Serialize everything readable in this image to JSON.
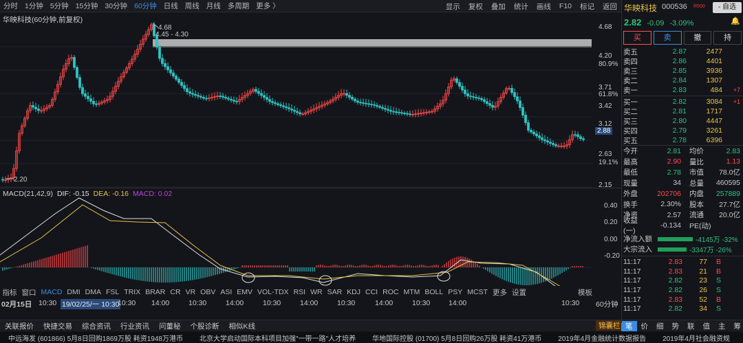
{
  "toolbar": {
    "timeframes": [
      "分时",
      "1分钟",
      "5分钟",
      "15分钟",
      "30分钟",
      "60分钟",
      "日线",
      "周线",
      "月线",
      "多周期",
      "更多 〉"
    ],
    "active_timeframe": "60分钟",
    "right_items": [
      "显示",
      "复权",
      "叠加",
      "统计",
      "画线",
      "F10",
      "标记",
      "返回"
    ]
  },
  "chart": {
    "title": "华映科技(60分钟,前复权)",
    "high_label": "4.68",
    "range_label": "4.45 - 4.30",
    "low_label": "2.20",
    "current_price_tag": "2.88",
    "price_axis": [
      "4.68",
      "4.20",
      "80.9%",
      "3.71",
      "61.8%",
      "3.42",
      "3.12",
      "2.88",
      "2.63",
      "19.1%",
      "2.15"
    ]
  },
  "macd": {
    "name": "MACD(21,42,9)",
    "dif_label": "DIF: -0.15",
    "dea_label": "DEA: -0.16",
    "macd_label": "MACD: 0.02",
    "axis": [
      "0.40",
      "0.20",
      "0.00",
      "-0.20"
    ]
  },
  "indicator_tabs": [
    "指标",
    "窗口",
    "MACD",
    "DMI",
    "DMA",
    "FSL",
    "TRIX",
    "BRAR",
    "CR",
    "VR",
    "OBV",
    "ASI",
    "EMV",
    "VOL-TDX",
    "RSI",
    "WR",
    "SAR",
    "KDJ",
    "CCI",
    "ROC",
    "MTM",
    "BOLL",
    "PSY",
    "MCST",
    "更多",
    "设置"
  ],
  "active_indicator": "MACD",
  "template_label": "模板",
  "time_axis": [
    "02月15日",
    "10:30",
    "19/02/25/一 10:30",
    "10:30",
    "14:00",
    "10:30",
    "14:00",
    "10:30",
    "14:00",
    "10:30",
    "14:00",
    "10:30",
    "14:00",
    "10:30",
    "60分钟"
  ],
  "bottom_tabs": [
    "关联报价",
    "快捷交易",
    "综合资讯",
    "行业资讯",
    "问董秘",
    "个股诊断",
    "相似K线"
  ],
  "luck_label": "锦囊栏",
  "side_tabs": [
    "笔",
    "价",
    "细",
    "势",
    "联",
    "值",
    "主",
    "筹"
  ],
  "active_side_tab": "笔",
  "news": [
    "中远海发 (601866) 5月8日回购1869万股 耗资1948万港币",
    "北京大学启动国际本科项目加强\"一带一路\"人才培养",
    "华地国际控股 (01700) 5月8日回购26万股 耗资41万港币",
    "2019年4月金融统计数据报告",
    "2019年4月社会融资规"
  ],
  "quote": {
    "name": "华映科技",
    "code": "000536",
    "badge": "R500",
    "watch_button": "- 自选",
    "price": "2.82",
    "change": "-0.09",
    "pct": "-3.09%",
    "buttons": [
      "买",
      "卖",
      "撤",
      "持"
    ],
    "asks": [
      {
        "label": "卖五",
        "price": "2.87",
        "vol": "2477",
        "delta": ""
      },
      {
        "label": "卖四",
        "price": "2.86",
        "vol": "4401",
        "delta": ""
      },
      {
        "label": "卖三",
        "price": "2.85",
        "vol": "3936",
        "delta": ""
      },
      {
        "label": "卖二",
        "price": "2.84",
        "vol": "1307",
        "delta": ""
      },
      {
        "label": "卖一",
        "price": "2.83",
        "vol": "484",
        "delta": "+7"
      }
    ],
    "bids": [
      {
        "label": "买一",
        "price": "2.82",
        "vol": "3084",
        "delta": "+1"
      },
      {
        "label": "买二",
        "price": "2.81",
        "vol": "1717",
        "delta": ""
      },
      {
        "label": "买三",
        "price": "2.80",
        "vol": "4447",
        "delta": ""
      },
      {
        "label": "买四",
        "price": "2.79",
        "vol": "3261",
        "delta": ""
      },
      {
        "label": "买五",
        "price": "2.78",
        "vol": "6396",
        "delta": ""
      }
    ],
    "stats": [
      {
        "k": "今开",
        "v": "2.81",
        "vc": "grn",
        "k2": "均价",
        "v2": "2.83",
        "v2c": "grn"
      },
      {
        "k": "最高",
        "v": "2.90",
        "vc": "red",
        "k2": "量比",
        "v2": "1.13",
        "v2c": "red"
      },
      {
        "k": "最低",
        "v": "2.78",
        "vc": "grn",
        "k2": "市值",
        "v2": "78.0亿",
        "v2c": ""
      },
      {
        "k": "现量",
        "v": "34",
        "vc": "",
        "k2": "总量",
        "v2": "460595",
        "v2c": ""
      },
      {
        "k": "外盘",
        "v": "202706",
        "vc": "red",
        "k2": "内盘",
        "v2": "257889",
        "v2c": "grn"
      },
      {
        "k": "换手",
        "v": "2.30%",
        "vc": "",
        "k2": "股本",
        "v2": "27.7亿",
        "v2c": ""
      },
      {
        "k": "净资",
        "v": "2.57",
        "vc": "",
        "k2": "流通",
        "v2": "20.0亿",
        "v2c": ""
      },
      {
        "k": "收益(一)",
        "v": "-0.134",
        "vc": "",
        "k2": "PE(动)",
        "v2": "",
        "v2c": ""
      }
    ],
    "flows": [
      {
        "label": "净流入额",
        "value": "-4145万 -32%",
        "bar_fraction": 0.32
      },
      {
        "label": "大宗流入",
        "value": "-3347万 -26%",
        "bar_fraction": 0.26
      }
    ],
    "ticks": [
      {
        "time": "11:17",
        "price": "2.83",
        "vol": "77",
        "side": "B"
      },
      {
        "time": "11:17",
        "price": "2.83",
        "vol": "21",
        "side": "B"
      },
      {
        "time": "11:17",
        "price": "2.82",
        "vol": "23",
        "side": "S"
      },
      {
        "time": "11:17",
        "price": "2.82",
        "vol": "26",
        "side": "S"
      },
      {
        "time": "11:17",
        "price": "2.83",
        "vol": "52",
        "side": "B"
      },
      {
        "time": "11:17",
        "price": "2.82",
        "vol": "34",
        "side": "S"
      }
    ]
  },
  "colors": {
    "up": "#ff4a4a",
    "down": "#2ec4c4",
    "dif_line": "#e0e0e0",
    "dea_line": "#e8c348",
    "accent": "#3a8de0"
  }
}
